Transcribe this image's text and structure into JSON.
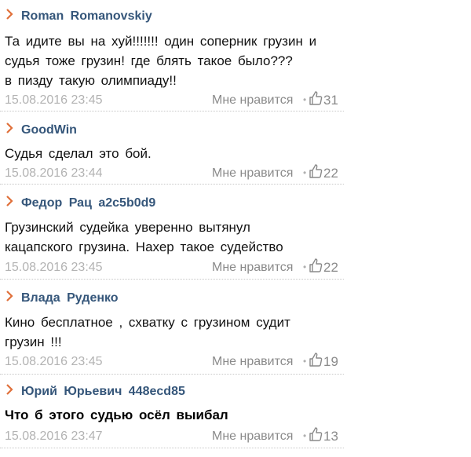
{
  "like_label": "Мне нравится",
  "comments": [
    {
      "author": "Roman  Romanovskiy",
      "text": "Та идите  вы  на хуй!!!!!!!  один  соперник  грузин и\nсудья  тоже  грузин!  где блять  такое  было???\nв пизду  такую  олимпиаду!!",
      "date": "15.08.2016 23:45",
      "likes": "31"
    },
    {
      "author": "GoodWin",
      "text": "Судья  сделал  это  бой.",
      "date": "15.08.2016 23:44",
      "likes": "22"
    },
    {
      "author": "Федор  Рац  a2c5b0d9",
      "text": "Грузинский  судейка  уверенно  вытянул\nкацапского  грузина.  Нахер  такое  судейство",
      "date": "15.08.2016 23:45",
      "likes": "22"
    },
    {
      "author": "Влада  Руденко",
      "text": "Кино  бесплатное   , схватку  с  грузином  судит\nгрузин  !!!",
      "date": "15.08.2016 23:45",
      "likes": "19"
    },
    {
      "author": "Юрий  Юрьевич  448ecd85",
      "text": "Что  б  этого  судью  осёл  выибал",
      "date": "15.08.2016 23:47",
      "likes": "13"
    }
  ],
  "colors": {
    "author": "#35567a",
    "chevron": "#e0703a",
    "date": "#b3b3b3",
    "meta": "#8a8a8a"
  },
  "icons": {
    "author_marker": "chevron-right-icon",
    "like": "thumbs-up-icon"
  }
}
